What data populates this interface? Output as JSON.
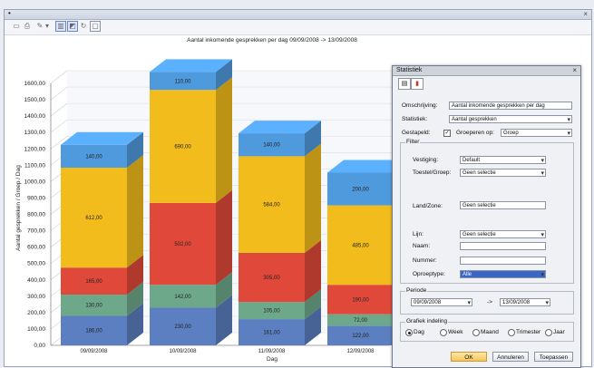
{
  "window": {
    "title_mark": "•",
    "close": "×"
  },
  "toolbar": {
    "icons": [
      "print-preview-icon",
      "print-icon",
      "edit-icon",
      "dropdown-arrow-icon",
      "chart-view-icon",
      "chart-3d-icon",
      "refresh-icon",
      "window-icon"
    ]
  },
  "chart_data": {
    "type": "bar",
    "stacked": true,
    "three_d": true,
    "title": "Aantal inkomende gesprekken per dag 09/09/2008 -> 13/09/2008",
    "xlabel": "Dag",
    "ylabel": "Aantal gesprekken / Groep / Dag",
    "ylim": [
      0,
      1600
    ],
    "yticks": [
      "0,00",
      "100,00",
      "200,00",
      "300,00",
      "400,00",
      "500,00",
      "600,00",
      "700,00",
      "800,00",
      "900,00",
      "1000,00",
      "1100,00",
      "1200,00",
      "1300,00",
      "1400,00",
      "1500,00",
      "1600,00"
    ],
    "categories": [
      "09/09/2008",
      "10/09/2008",
      "11/09/2008",
      "12/09/2008"
    ],
    "colors": [
      "#5b7fc0",
      "#6ea88a",
      "#e0493a",
      "#f2bd1c",
      "#4f9adc"
    ],
    "series": [
      {
        "values": [
          180,
          230,
          160,
          120
        ],
        "labels": [
          "186,00",
          "230,00",
          "161,00",
          "122,00"
        ]
      },
      {
        "values": [
          130,
          140,
          105,
          70
        ],
        "labels": [
          "130,00",
          "142,00",
          "105,00",
          "72,00"
        ]
      },
      {
        "values": [
          165,
          500,
          300,
          180
        ],
        "labels": [
          "165,00",
          "502,00",
          "305,00",
          "190,00"
        ]
      },
      {
        "values": [
          610,
          690,
          590,
          485
        ],
        "labels": [
          "612,00",
          "690,00",
          "584,00",
          "485,00"
        ]
      },
      {
        "values": [
          140,
          110,
          140,
          200
        ],
        "labels": [
          "140,00",
          "110,00",
          "140,00",
          "200,00"
        ]
      }
    ]
  },
  "dialog": {
    "title": "Statistiek",
    "close": "×",
    "omschrijving_label": "Omschrijving:",
    "omschrijving_value": "Aantal inkomende gesprekken per dag",
    "statistiek_label": "Statistiek:",
    "statistiek_value": "Aantal gesprekken",
    "gestapeld_label": "Gestapeld:",
    "gestapeld_checked": "✓",
    "groeperen_label": "Groeperen op:",
    "groeperen_value": "Groep",
    "filter_label": "Filter",
    "vestiging_label": "Vestiging:",
    "vestiging_value": "Default",
    "toestel_label": "Toestel/Groep:",
    "toestel_value": "Geen selectie",
    "land_label": "Land/Zone:",
    "land_value": "Geen selectie",
    "lijn_label": "Lijn:",
    "lijn_value": "Geen selectie",
    "naam_label": "Naam:",
    "naam_value": "",
    "nummer_label": "Nummer:",
    "nummer_value": "",
    "oproeptype_label": "Oproeptype:",
    "oproeptype_value": "Alle",
    "periode_label": "Periode",
    "periode_from": "09/09/2008",
    "periode_sep": "->",
    "periode_to": "13/09/2008",
    "grafiek_label": "Grafiek indeling",
    "radio_dag": "Dag",
    "radio_week": "Week",
    "radio_maand": "Maand",
    "radio_trimester": "Trimester",
    "radio_jaar": "Jaar",
    "ok_label": "OK",
    "annuleren_label": "Annuleren",
    "toepassen_label": "Toepassen"
  }
}
